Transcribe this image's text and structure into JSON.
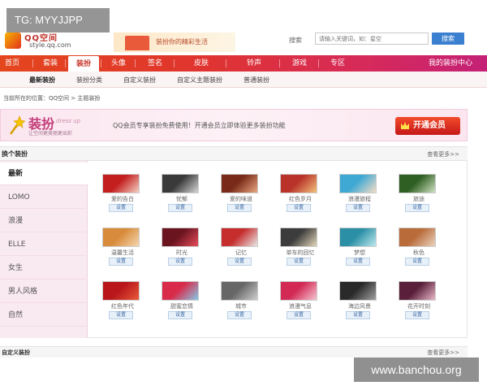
{
  "overlay": {
    "top_label": "TG: MYYJJPP",
    "watermark": "www.banchou.org"
  },
  "header": {
    "logo_text": "QQ空间",
    "logo_url": "style.qq.com",
    "banner_text": "装扮你的精彩生活",
    "search_label": "搜索",
    "search_placeholder": "请输入关键词，如：星空",
    "search_button": "搜索"
  },
  "nav": {
    "items": [
      {
        "label": "首页"
      },
      {
        "label": "套装"
      },
      {
        "label": "装扮"
      },
      {
        "label": "头像"
      },
      {
        "label": "签名"
      },
      {
        "label": "皮肤"
      },
      {
        "label": "铃声"
      },
      {
        "label": "游戏"
      },
      {
        "label": "专区"
      },
      {
        "label": "我的装扮中心"
      }
    ],
    "active_index": 2
  },
  "subnav": {
    "items": [
      {
        "label": "最新装扮"
      },
      {
        "label": "装扮分类"
      },
      {
        "label": "自定义装扮"
      },
      {
        "label": "自定义主题装扮"
      },
      {
        "label": "普通装扮"
      }
    ]
  },
  "breadcrumb": "当前所在的位置：QQ空间 > 主题装扮",
  "promo": {
    "title": "装扮",
    "title_en": "dress up",
    "subtitle": "让空间更美丽更出彩",
    "text": "QQ会员专享装扮免费使用！开通会员立即体验更多装扮功能",
    "vip_button": "开通会员"
  },
  "section": {
    "title": "换个装扮",
    "more": "查看更多>>"
  },
  "categories": [
    {
      "label": "最新"
    },
    {
      "label": "LOMO"
    },
    {
      "label": "浪漫"
    },
    {
      "label": "ELLE"
    },
    {
      "label": "女生"
    },
    {
      "label": "男人风格"
    },
    {
      "label": "自然"
    }
  ],
  "active_category": 0,
  "set_label": "设置",
  "themes": [
    {
      "label": "爱的告白",
      "colors": [
        "#c41f1f",
        "#f3d0c4"
      ]
    },
    {
      "label": "忧郁",
      "colors": [
        "#3a3a3a",
        "#d6d6d6"
      ]
    },
    {
      "label": "爱的味道",
      "colors": [
        "#7a2a18",
        "#e8a882"
      ]
    },
    {
      "label": "红色岁月",
      "colors": [
        "#b9332a",
        "#f2c17a"
      ]
    },
    {
      "label": "浪漫旅程",
      "colors": [
        "#3fa9d4",
        "#f5ddc6"
      ]
    },
    {
      "label": "旅途",
      "colors": [
        "#2f5f22",
        "#cfe1c2"
      ]
    },
    {
      "label": "温馨生活",
      "colors": [
        "#d88b3a",
        "#f4d7b0"
      ]
    },
    {
      "label": "时光",
      "colors": [
        "#6a1420",
        "#e74c5a"
      ]
    },
    {
      "label": "记忆",
      "colors": [
        "#c62d2d",
        "#e9e9e9"
      ]
    },
    {
      "label": "单车的回忆",
      "colors": [
        "#3c3c3c",
        "#e2d6b8"
      ]
    },
    {
      "label": "梦想",
      "colors": [
        "#2b8fa5",
        "#bfe9ef"
      ]
    },
    {
      "label": "秋色",
      "colors": [
        "#b96b3a",
        "#ead3bf"
      ]
    },
    {
      "label": "红色年代",
      "colors": [
        "#b8161a",
        "#e85a3a"
      ]
    },
    {
      "label": "甜蜜恋情",
      "colors": [
        "#d92a4a",
        "#85c9e8"
      ]
    },
    {
      "label": "城市",
      "colors": [
        "#666666",
        "#cfcfcf"
      ]
    },
    {
      "label": "浪漫气息",
      "colors": [
        "#d22a55",
        "#f5c6d3"
      ]
    },
    {
      "label": "海边风景",
      "colors": [
        "#2a2a2a",
        "#a0a0a0"
      ]
    },
    {
      "label": "花开时刻",
      "colors": [
        "#5a1f3a",
        "#e8b8c8"
      ]
    }
  ],
  "bottom": {
    "title": "自定义装扮",
    "more": "查看更多>>"
  }
}
